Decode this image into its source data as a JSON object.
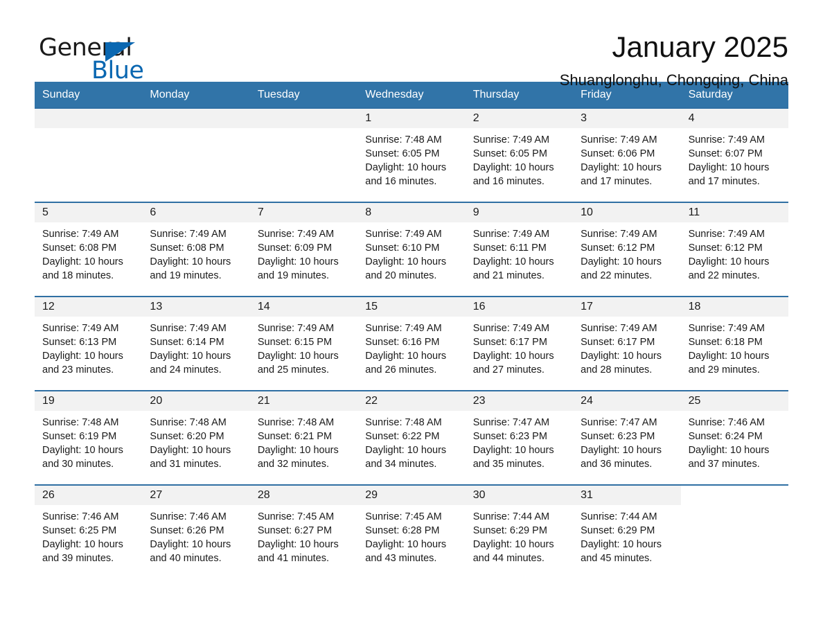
{
  "logo": {
    "word_one": "General",
    "word_two": "Blue",
    "triangle_color": "#0a67b1"
  },
  "header": {
    "title": "January 2025",
    "subtitle": "Shuanglonghu, Chongqing, China"
  },
  "theme": {
    "header_blue": "#3174a8",
    "row_rule_blue": "#2f6fa3",
    "day_number_bg": "#f2f2f2",
    "text": "#1a1a1a"
  },
  "calendar": {
    "weekdays": [
      "Sunday",
      "Monday",
      "Tuesday",
      "Wednesday",
      "Thursday",
      "Friday",
      "Saturday"
    ],
    "labels": {
      "sunrise": "Sunrise:",
      "sunset": "Sunset:",
      "daylight": "Daylight:"
    },
    "weeks": [
      [
        {
          "day": "",
          "empty": true
        },
        {
          "day": "",
          "empty": true
        },
        {
          "day": "",
          "empty": true
        },
        {
          "day": "1",
          "sunrise": "Sunrise: 7:48 AM",
          "sunset": "Sunset: 6:05 PM",
          "daylight": "Daylight: 10 hours and 16 minutes."
        },
        {
          "day": "2",
          "sunrise": "Sunrise: 7:49 AM",
          "sunset": "Sunset: 6:05 PM",
          "daylight": "Daylight: 10 hours and 16 minutes."
        },
        {
          "day": "3",
          "sunrise": "Sunrise: 7:49 AM",
          "sunset": "Sunset: 6:06 PM",
          "daylight": "Daylight: 10 hours and 17 minutes."
        },
        {
          "day": "4",
          "sunrise": "Sunrise: 7:49 AM",
          "sunset": "Sunset: 6:07 PM",
          "daylight": "Daylight: 10 hours and 17 minutes."
        }
      ],
      [
        {
          "day": "5",
          "sunrise": "Sunrise: 7:49 AM",
          "sunset": "Sunset: 6:08 PM",
          "daylight": "Daylight: 10 hours and 18 minutes."
        },
        {
          "day": "6",
          "sunrise": "Sunrise: 7:49 AM",
          "sunset": "Sunset: 6:08 PM",
          "daylight": "Daylight: 10 hours and 19 minutes."
        },
        {
          "day": "7",
          "sunrise": "Sunrise: 7:49 AM",
          "sunset": "Sunset: 6:09 PM",
          "daylight": "Daylight: 10 hours and 19 minutes."
        },
        {
          "day": "8",
          "sunrise": "Sunrise: 7:49 AM",
          "sunset": "Sunset: 6:10 PM",
          "daylight": "Daylight: 10 hours and 20 minutes."
        },
        {
          "day": "9",
          "sunrise": "Sunrise: 7:49 AM",
          "sunset": "Sunset: 6:11 PM",
          "daylight": "Daylight: 10 hours and 21 minutes."
        },
        {
          "day": "10",
          "sunrise": "Sunrise: 7:49 AM",
          "sunset": "Sunset: 6:12 PM",
          "daylight": "Daylight: 10 hours and 22 minutes."
        },
        {
          "day": "11",
          "sunrise": "Sunrise: 7:49 AM",
          "sunset": "Sunset: 6:12 PM",
          "daylight": "Daylight: 10 hours and 22 minutes."
        }
      ],
      [
        {
          "day": "12",
          "sunrise": "Sunrise: 7:49 AM",
          "sunset": "Sunset: 6:13 PM",
          "daylight": "Daylight: 10 hours and 23 minutes."
        },
        {
          "day": "13",
          "sunrise": "Sunrise: 7:49 AM",
          "sunset": "Sunset: 6:14 PM",
          "daylight": "Daylight: 10 hours and 24 minutes."
        },
        {
          "day": "14",
          "sunrise": "Sunrise: 7:49 AM",
          "sunset": "Sunset: 6:15 PM",
          "daylight": "Daylight: 10 hours and 25 minutes."
        },
        {
          "day": "15",
          "sunrise": "Sunrise: 7:49 AM",
          "sunset": "Sunset: 6:16 PM",
          "daylight": "Daylight: 10 hours and 26 minutes."
        },
        {
          "day": "16",
          "sunrise": "Sunrise: 7:49 AM",
          "sunset": "Sunset: 6:17 PM",
          "daylight": "Daylight: 10 hours and 27 minutes."
        },
        {
          "day": "17",
          "sunrise": "Sunrise: 7:49 AM",
          "sunset": "Sunset: 6:17 PM",
          "daylight": "Daylight: 10 hours and 28 minutes."
        },
        {
          "day": "18",
          "sunrise": "Sunrise: 7:49 AM",
          "sunset": "Sunset: 6:18 PM",
          "daylight": "Daylight: 10 hours and 29 minutes."
        }
      ],
      [
        {
          "day": "19",
          "sunrise": "Sunrise: 7:48 AM",
          "sunset": "Sunset: 6:19 PM",
          "daylight": "Daylight: 10 hours and 30 minutes."
        },
        {
          "day": "20",
          "sunrise": "Sunrise: 7:48 AM",
          "sunset": "Sunset: 6:20 PM",
          "daylight": "Daylight: 10 hours and 31 minutes."
        },
        {
          "day": "21",
          "sunrise": "Sunrise: 7:48 AM",
          "sunset": "Sunset: 6:21 PM",
          "daylight": "Daylight: 10 hours and 32 minutes."
        },
        {
          "day": "22",
          "sunrise": "Sunrise: 7:48 AM",
          "sunset": "Sunset: 6:22 PM",
          "daylight": "Daylight: 10 hours and 34 minutes."
        },
        {
          "day": "23",
          "sunrise": "Sunrise: 7:47 AM",
          "sunset": "Sunset: 6:23 PM",
          "daylight": "Daylight: 10 hours and 35 minutes."
        },
        {
          "day": "24",
          "sunrise": "Sunrise: 7:47 AM",
          "sunset": "Sunset: 6:23 PM",
          "daylight": "Daylight: 10 hours and 36 minutes."
        },
        {
          "day": "25",
          "sunrise": "Sunrise: 7:46 AM",
          "sunset": "Sunset: 6:24 PM",
          "daylight": "Daylight: 10 hours and 37 minutes."
        }
      ],
      [
        {
          "day": "26",
          "sunrise": "Sunrise: 7:46 AM",
          "sunset": "Sunset: 6:25 PM",
          "daylight": "Daylight: 10 hours and 39 minutes."
        },
        {
          "day": "27",
          "sunrise": "Sunrise: 7:46 AM",
          "sunset": "Sunset: 6:26 PM",
          "daylight": "Daylight: 10 hours and 40 minutes."
        },
        {
          "day": "28",
          "sunrise": "Sunrise: 7:45 AM",
          "sunset": "Sunset: 6:27 PM",
          "daylight": "Daylight: 10 hours and 41 minutes."
        },
        {
          "day": "29",
          "sunrise": "Sunrise: 7:45 AM",
          "sunset": "Sunset: 6:28 PM",
          "daylight": "Daylight: 10 hours and 43 minutes."
        },
        {
          "day": "30",
          "sunrise": "Sunrise: 7:44 AM",
          "sunset": "Sunset: 6:29 PM",
          "daylight": "Daylight: 10 hours and 44 minutes."
        },
        {
          "day": "31",
          "sunrise": "Sunrise: 7:44 AM",
          "sunset": "Sunset: 6:29 PM",
          "daylight": "Daylight: 10 hours and 45 minutes."
        },
        {
          "day": "",
          "empty": true,
          "blank": true
        }
      ]
    ]
  }
}
